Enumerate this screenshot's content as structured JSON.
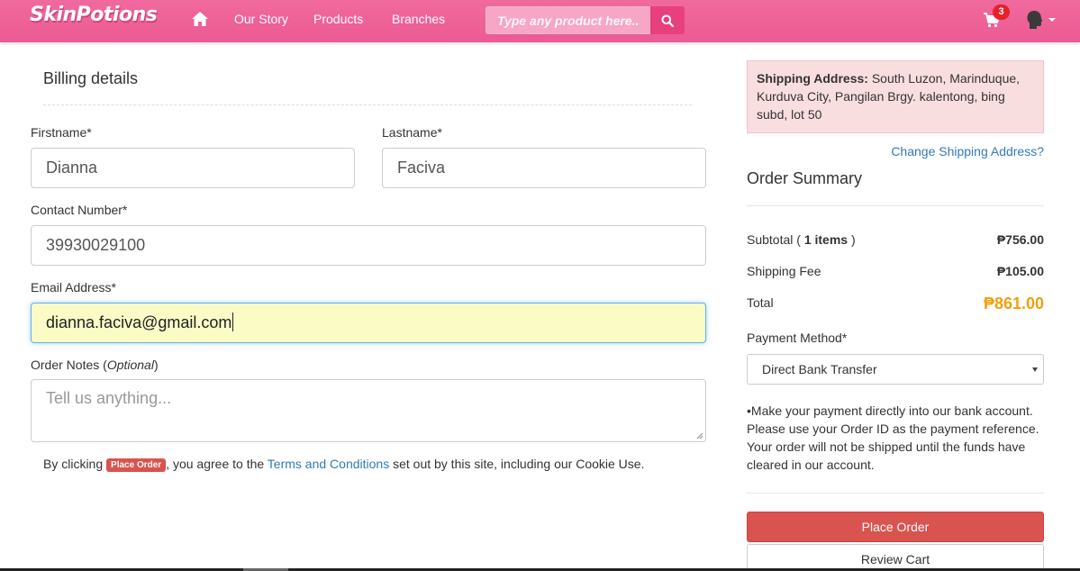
{
  "nav": {
    "logo": "SkinPotions",
    "links": [
      "Our Story",
      "Products",
      "Branches"
    ],
    "search_placeholder": "Type any product here...",
    "cart_count": "3"
  },
  "billing": {
    "title": "Billing details",
    "firstname_label": "Firstname*",
    "firstname_value": "Dianna",
    "lastname_label": "Lastname*",
    "lastname_value": "Faciva",
    "contact_label": "Contact Number*",
    "contact_value": "39930029100",
    "email_label": "Email Address*",
    "email_value": "dianna.faciva@gmail.com",
    "notes_label_prefix": "Order Notes (",
    "notes_label_optional": "Optional",
    "notes_label_suffix": ")",
    "notes_placeholder": "Tell us anything...",
    "terms_prefix": "By clicking ",
    "terms_button": "Place Order",
    "terms_middle": ", you agree to the ",
    "terms_link": "Terms and Conditions",
    "terms_suffix": " set out by this site, including our Cookie Use."
  },
  "summary": {
    "shipping_label": "Shipping Address:",
    "shipping_address": " South Luzon, Marinduque, Kurduva City, Pangilan Brgy. kalentong, bing subd, lot 50",
    "change_link": "Change Shipping Address?",
    "title": "Order Summary",
    "subtotal_label_prefix": "Subtotal ( ",
    "subtotal_items": "1 items",
    "subtotal_label_suffix": " )",
    "subtotal_value": "₱756.00",
    "shipping_fee_label": "Shipping Fee",
    "shipping_fee_value": "₱105.00",
    "total_label": "Total",
    "total_value": "₱861.00",
    "payment_label": "Payment Method*",
    "payment_selected": "Direct Bank Transfer",
    "payment_note": "•Make your payment directly into our bank account. Please use your Order ID as the payment reference. Your order will not be shipped until the funds have cleared in our account.",
    "place_order": "Place Order",
    "review_cart": "Review Cart"
  },
  "colors": {
    "brand_pink": "#ec5a92",
    "danger": "#d9534f",
    "total_orange": "#f0a010",
    "link_blue": "#337ab7"
  },
  "icons": [
    "home-icon",
    "search-icon",
    "cart-icon",
    "user-icon",
    "caret-down-icon"
  ]
}
